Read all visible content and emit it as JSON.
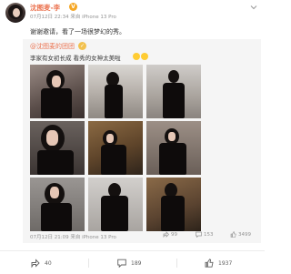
{
  "post": {
    "author": "沈图麦-李",
    "meta": "07月12日 22:34 来自 iPhone 13 Pro",
    "text": "谢谢邀请，看了一场很梦幻的秀。"
  },
  "repost": {
    "author": "@沈图麦的团团",
    "text": "李家有女初长成 看秀的女神太美啦",
    "footer": "07月12日 21:09 来自 iPhone 13 Pro",
    "stats": {
      "share": "99",
      "comment": "153",
      "like": "3499"
    }
  },
  "actions": {
    "share": "40",
    "comment": "189",
    "like": "1937"
  },
  "colors": {
    "author": "#eb7350",
    "meta": "#939393",
    "repost_bg": "#f5f5f5"
  },
  "icons": [
    "more-icon",
    "vip-badge-icon",
    "share-icon",
    "comment-icon",
    "like-icon"
  ]
}
